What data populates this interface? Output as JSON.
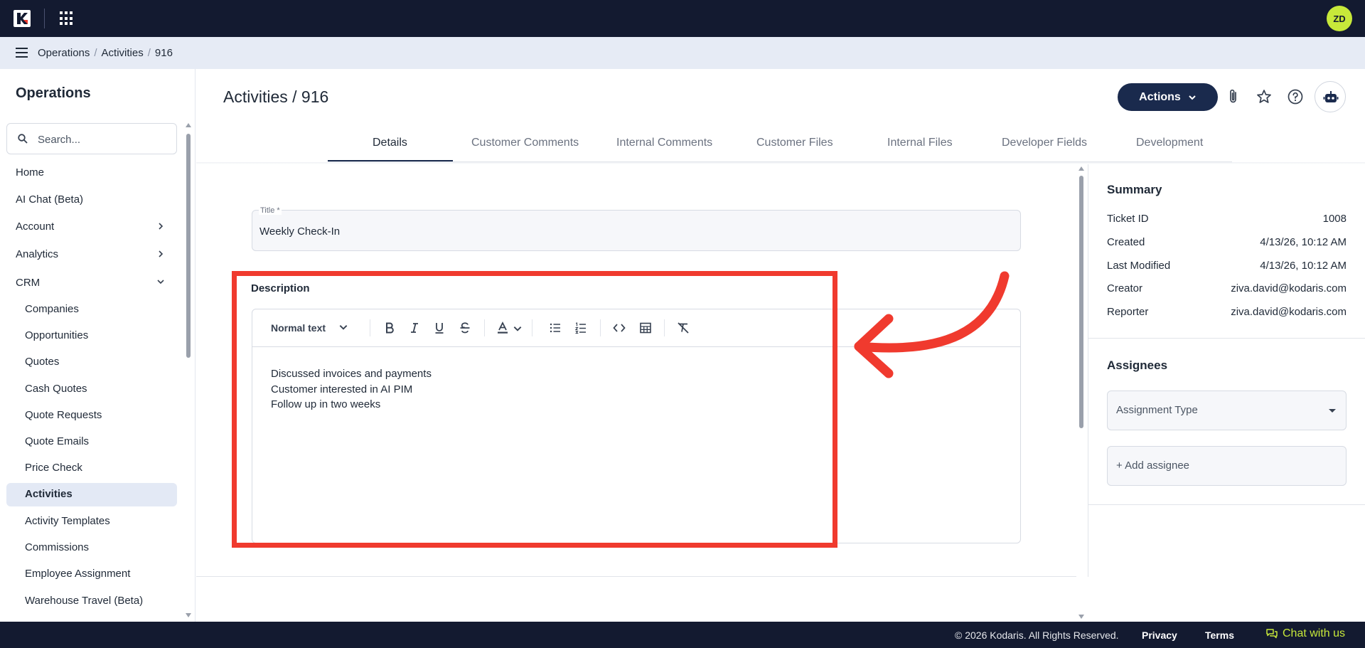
{
  "topbar": {
    "logo_icon": "kodaris-logo-icon",
    "apps_icon": "apps-grid-icon",
    "avatar_initials": "ZD",
    "avatar_color": "#c7e83a"
  },
  "breadcrumb": {
    "items": [
      "Operations",
      "Activities",
      "916"
    ]
  },
  "sidebar": {
    "title": "Operations",
    "search_placeholder": "Search...",
    "items": [
      {
        "label": "Home"
      },
      {
        "label": "AI Chat (Beta)"
      },
      {
        "label": "Account",
        "chevron": "right"
      },
      {
        "label": "Analytics",
        "chevron": "right"
      },
      {
        "label": "CRM",
        "chevron": "down"
      }
    ],
    "crm_items": [
      {
        "label": "Companies"
      },
      {
        "label": "Opportunities"
      },
      {
        "label": "Quotes"
      },
      {
        "label": "Cash Quotes"
      },
      {
        "label": "Quote Requests"
      },
      {
        "label": "Quote Emails"
      },
      {
        "label": "Price Check"
      },
      {
        "label": "Activities",
        "active": true
      },
      {
        "label": "Activity Templates"
      },
      {
        "label": "Commissions"
      },
      {
        "label": "Employee Assignment"
      },
      {
        "label": "Warehouse Travel (Beta)"
      }
    ]
  },
  "header": {
    "title": "Activities / 916",
    "actions_label": "Actions",
    "icons": [
      "paperclip-icon",
      "star-icon",
      "help-icon",
      "robot-icon"
    ]
  },
  "tabs": [
    {
      "label": "Details",
      "active": true
    },
    {
      "label": "Customer Comments"
    },
    {
      "label": "Internal Comments"
    },
    {
      "label": "Customer Files"
    },
    {
      "label": "Internal Files"
    },
    {
      "label": "Developer Fields"
    },
    {
      "label": "Development"
    }
  ],
  "form": {
    "title_label": "Title *",
    "title_value": "Weekly Check-In",
    "description_label": "Description",
    "editor": {
      "format_select": "Normal text",
      "lines": [
        "Discussed invoices and payments",
        "Customer interested in AI PIM",
        "Follow up in two weeks"
      ]
    }
  },
  "summary": {
    "title": "Summary",
    "rows": [
      {
        "label": "Ticket ID",
        "value": "1008"
      },
      {
        "label": "Created",
        "value": "4/13/26, 10:12 AM"
      },
      {
        "label": "Last Modified",
        "value": "4/13/26, 10:12 AM"
      },
      {
        "label": "Creator",
        "value": "ziva.david@kodaris.com"
      },
      {
        "label": "Reporter",
        "value": "ziva.david@kodaris.com"
      }
    ]
  },
  "assignees": {
    "title": "Assignees",
    "type_placeholder": "Assignment Type",
    "add_label": "+ Add assignee"
  },
  "footer": {
    "copyright": "© 2026 Kodaris. All Rights Reserved.",
    "privacy": "Privacy",
    "terms": "Terms",
    "chat": "Chat with us"
  },
  "colors": {
    "topbar": "#131a30",
    "accent": "#1a2a4d",
    "annotation": "#f03a2e",
    "chat": "#c7e83a"
  }
}
